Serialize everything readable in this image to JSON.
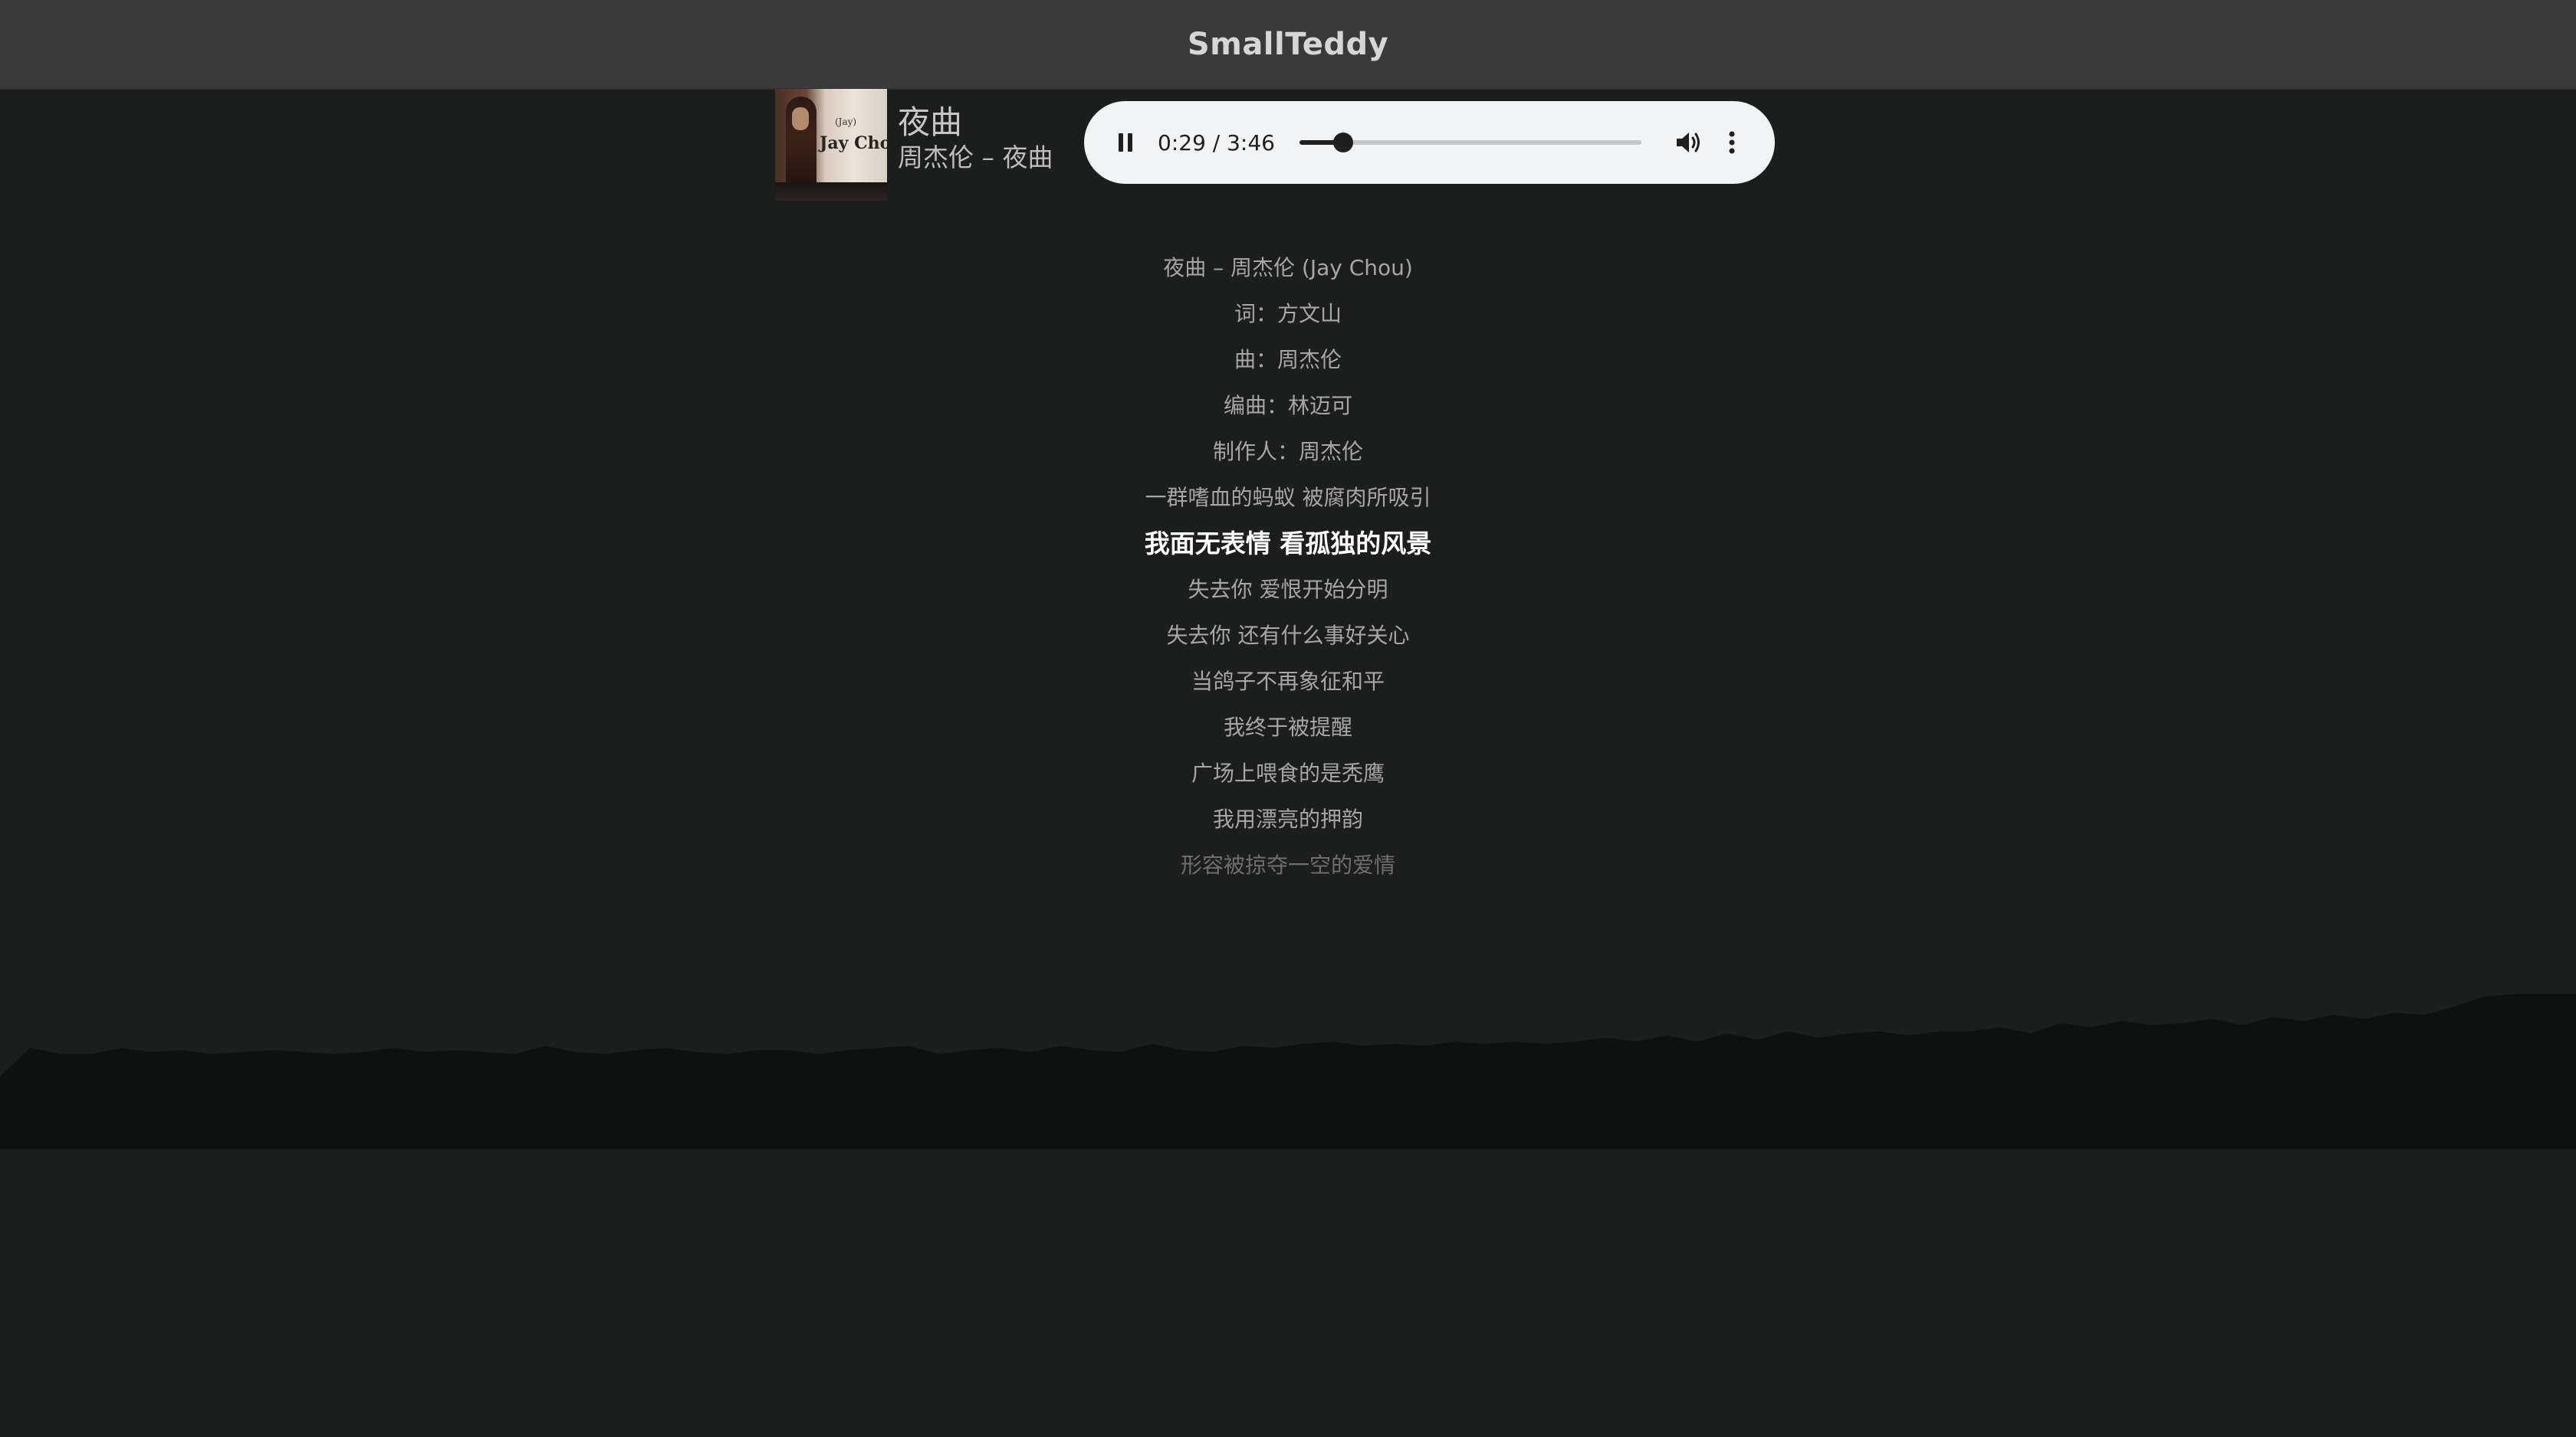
{
  "app": {
    "title": "SmallTeddy"
  },
  "track": {
    "title": "夜曲",
    "subtitle": "周杰伦 – 夜曲",
    "cover_text": "Jay Chou",
    "cover_small": "(Jay)"
  },
  "player": {
    "state": "playing",
    "time_display": "0:29 / 3:46",
    "current_seconds": 29,
    "duration_seconds": 226,
    "icons": {
      "play_pause": "pause-icon",
      "volume": "volume-icon",
      "more": "more-vertical-icon"
    }
  },
  "lyrics": {
    "current_index": 6,
    "lines": [
      "夜曲 – 周杰伦 (Jay Chou)",
      "词：方文山",
      "曲：周杰伦",
      "编曲：林迈可",
      "制作人：周杰伦",
      "一群嗜血的蚂蚁 被腐肉所吸引",
      "我面无表情 看孤独的风景",
      "失去你 爱恨开始分明",
      "失去你 还有什么事好关心",
      "当鸽子不再象征和平",
      "我终于被提醒",
      "广场上喂食的是秃鹰",
      "我用漂亮的押韵",
      "形容被掠夺一空的爱情"
    ]
  },
  "visualizer": {
    "color": "#0f1010",
    "levels": [
      0.16,
      0.3,
      0.27,
      0.27,
      0.3,
      0.28,
      0.29,
      0.27,
      0.28,
      0.29,
      0.28,
      0.27,
      0.28,
      0.3,
      0.28,
      0.29,
      0.28,
      0.27,
      0.31,
      0.28,
      0.27,
      0.29,
      0.3,
      0.28,
      0.27,
      0.29,
      0.29,
      0.27,
      0.29,
      0.3,
      0.31,
      0.27,
      0.29,
      0.3,
      0.28,
      0.31,
      0.29,
      0.28,
      0.32,
      0.29,
      0.28,
      0.31,
      0.3,
      0.32,
      0.33,
      0.31,
      0.32,
      0.31,
      0.33,
      0.32,
      0.33,
      0.32,
      0.33,
      0.35,
      0.33,
      0.36,
      0.33,
      0.37,
      0.34,
      0.38,
      0.35,
      0.37,
      0.38,
      0.36,
      0.38,
      0.38,
      0.4,
      0.37,
      0.42,
      0.4,
      0.43,
      0.41,
      0.42,
      0.44,
      0.41,
      0.45,
      0.43,
      0.46,
      0.44,
      0.47,
      0.46,
      0.5,
      0.55,
      0.56,
      0.56,
      0.56
    ]
  }
}
